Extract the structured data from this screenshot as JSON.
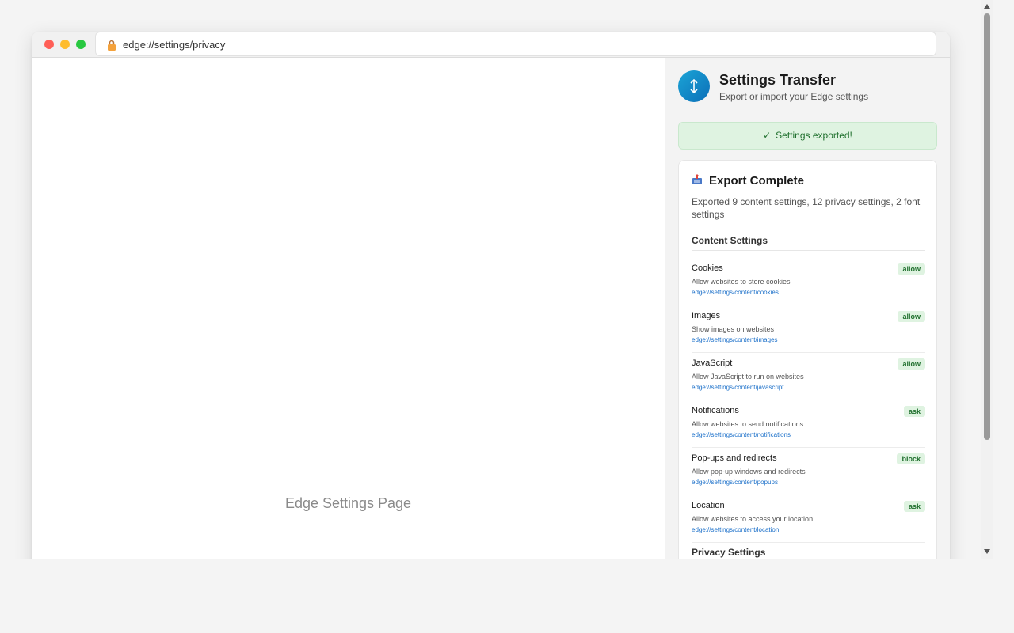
{
  "browser": {
    "url": "edge://settings/privacy"
  },
  "page": {
    "label": "Edge Settings Page"
  },
  "panel": {
    "title": "Settings Transfer",
    "subtitle": "Export or import your Edge settings",
    "status": "Settings exported!",
    "export_card": {
      "title": "Export Complete",
      "summary": "Exported 9 content settings, 12 privacy settings, 2 font settings",
      "content_section_title": "Content Settings",
      "privacy_section_title": "Privacy Settings",
      "items": [
        {
          "name": "Cookies",
          "desc": "Allow websites to store cookies",
          "link": "edge://settings/content/cookies",
          "value": "allow"
        },
        {
          "name": "Images",
          "desc": "Show images on websites",
          "link": "edge://settings/content/images",
          "value": "allow"
        },
        {
          "name": "JavaScript",
          "desc": "Allow JavaScript to run on websites",
          "link": "edge://settings/content/javascript",
          "value": "allow"
        },
        {
          "name": "Notifications",
          "desc": "Allow websites to send notifications",
          "link": "edge://settings/content/notifications",
          "value": "ask"
        },
        {
          "name": "Pop-ups and redirects",
          "desc": "Allow pop-up windows and redirects",
          "link": "edge://settings/content/popups",
          "value": "block"
        },
        {
          "name": "Location",
          "desc": "Allow websites to access your location",
          "link": "edge://settings/content/location",
          "value": "ask"
        }
      ]
    }
  },
  "colors": {
    "accent": "#0c6fb8",
    "success_bg": "#dff3e1",
    "success_text": "#1f6f2d",
    "link": "#1a6fc9"
  }
}
